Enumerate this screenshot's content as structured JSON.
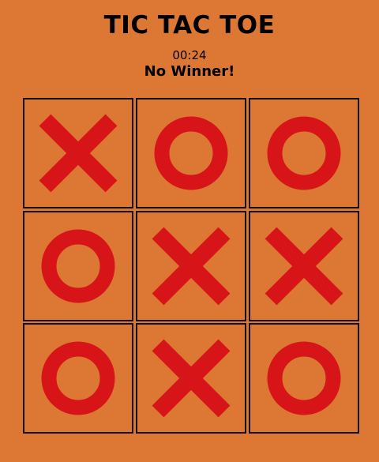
{
  "title": "TIC TAC TOE",
  "timer": "00:24",
  "status": "No Winner!",
  "colors": {
    "background": "#dc7734",
    "mark": "#d71518",
    "border": "#111111"
  },
  "board": [
    "X",
    "O",
    "O",
    "O",
    "X",
    "X",
    "O",
    "X",
    "O"
  ]
}
